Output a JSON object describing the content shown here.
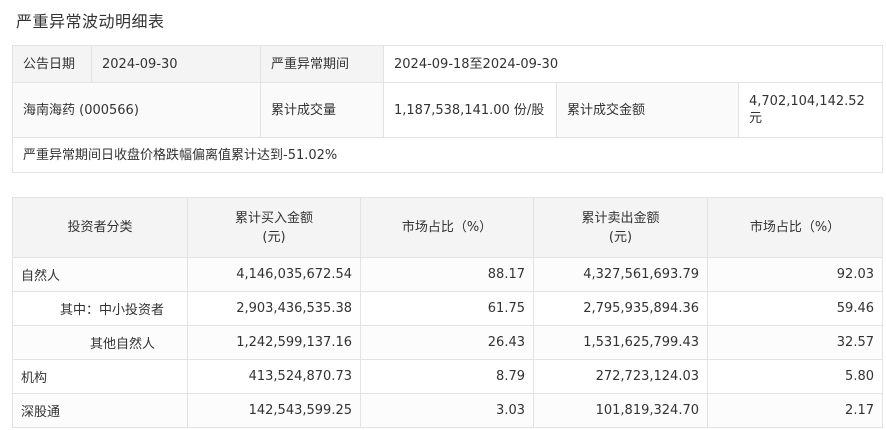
{
  "page": {
    "title": "严重异常波动明细表"
  },
  "summary": {
    "announce_date_label": "公告日期",
    "announce_date": "2024-09-30",
    "period_label": "严重异常期间",
    "period": "2024-09-18至2024-09-30",
    "stock": "海南海药 (000566)",
    "volume_label": "累计成交量",
    "volume": "1,187,538,141.00 份/股",
    "amount_label": "累计成交金额",
    "amount": "4,702,104,142.52 元",
    "note": "严重异常期间日收盘价格跌幅偏离值累计达到-51.02%"
  },
  "flows": {
    "headers": [
      "投资者分类",
      "累计买入金额\n(元)",
      "市场占比（%）",
      "累计卖出金额\n(元)",
      "市场占比（%）"
    ],
    "rows": [
      {
        "category": "自然人",
        "buy": "4,146,035,672.54",
        "buy_pct": "88.17",
        "sell": "4,327,561,693.79",
        "sell_pct": "92.03"
      },
      {
        "category": "其中：中小投资者",
        "buy": "2,903,436,535.38",
        "buy_pct": "61.75",
        "sell": "2,795,935,894.36",
        "sell_pct": "59.46"
      },
      {
        "category": "其他自然人",
        "buy": "1,242,599,137.16",
        "buy_pct": "26.43",
        "sell": "1,531,625,799.43",
        "sell_pct": "32.57"
      },
      {
        "category": "机构",
        "buy": "413,524,870.73",
        "buy_pct": "8.79",
        "sell": "272,723,124.03",
        "sell_pct": "5.80"
      },
      {
        "category": "深股通",
        "buy": "142,543,599.25",
        "buy_pct": "3.03",
        "sell": "101,819,324.70",
        "sell_pct": "2.17"
      }
    ]
  }
}
